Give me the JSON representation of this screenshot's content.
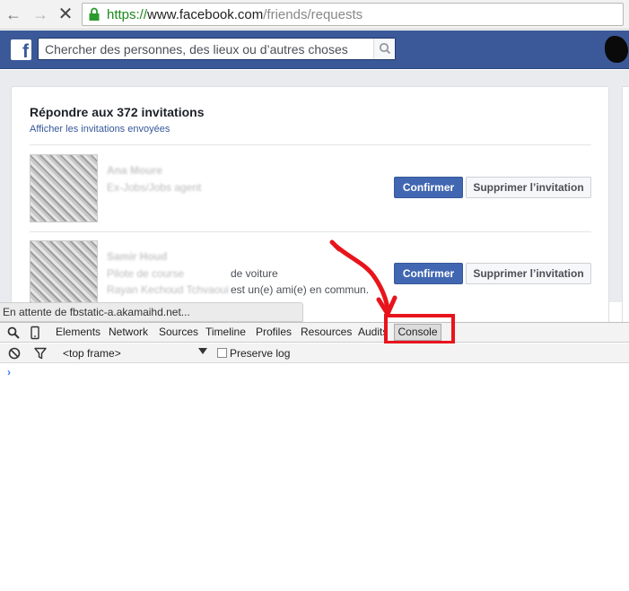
{
  "browser": {
    "url_scheme": "https://",
    "url_host": "www.facebook.com",
    "url_path": "/friends/requests"
  },
  "fb": {
    "logo": "f",
    "search_placeholder": "Chercher des personnes, des lieux ou d’autres choses"
  },
  "requests": {
    "title": "Répondre aux 372 invitations",
    "sent_link": "Afficher les invitations envoyées",
    "items": [
      {
        "name": "Ana Moure",
        "subtitle": "Ex-Jobs/Jobs agent",
        "confirm_label": "Confirmer",
        "delete_label": "Supprimer l’invitation"
      },
      {
        "name": "Samir Houd",
        "subtitle_blurred": "Pilote de course",
        "subtitle_clear": "de voiture",
        "mutual_blurred": "Rayan Kechoud Tchvaoui",
        "mutual_clear": "est un(e) ami(e) en commun.",
        "confirm_label": "Confirmer",
        "delete_label": "Supprimer l’invitation"
      }
    ]
  },
  "status_bubble": "En attente de fbstatic-a.akamaihd.net...",
  "devtools": {
    "tabs": [
      "Elements",
      "Network",
      "Sources",
      "Timeline",
      "Profiles",
      "Resources",
      "Audits"
    ],
    "active_tab": "Console",
    "frame_select": "<top frame>",
    "preserve_log": "Preserve log",
    "prompt": "›"
  },
  "colors": {
    "fb_blue": "#3b5998",
    "confirm_blue": "#4267b2",
    "annotation_red": "#e8141c",
    "url_green": "#1a8a1a"
  }
}
